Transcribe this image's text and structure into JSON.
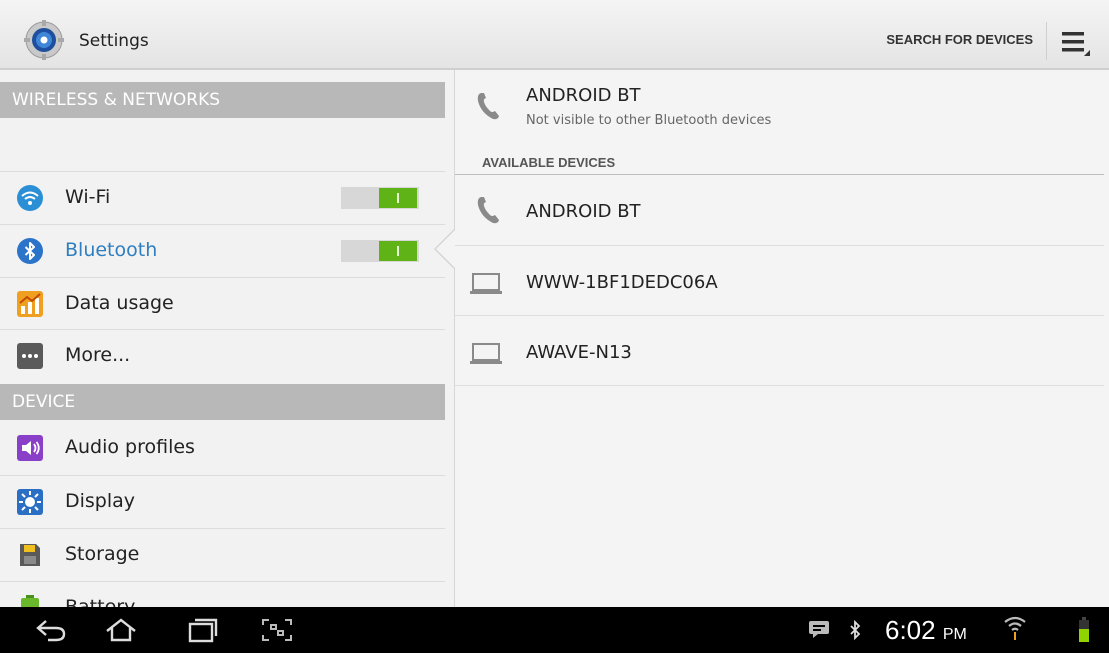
{
  "actionbar": {
    "title": "Settings",
    "search_label": "SEARCH FOR DEVICES"
  },
  "sidebar": {
    "sections": {
      "wireless": "WIRELESS & NETWORKS",
      "device": "DEVICE"
    },
    "items": {
      "wifi": {
        "label": "Wi-Fi",
        "toggle": "on"
      },
      "bluetooth": {
        "label": "Bluetooth",
        "toggle": "on",
        "selected": true
      },
      "data_usage": {
        "label": "Data usage"
      },
      "more": {
        "label": "More..."
      },
      "audio_profiles": {
        "label": "Audio profiles"
      },
      "display": {
        "label": "Display"
      },
      "storage": {
        "label": "Storage"
      },
      "battery": {
        "label": "Battery"
      }
    }
  },
  "bluetooth": {
    "this_device": {
      "name": "ANDROID BT",
      "status": "Not visible to other Bluetooth devices"
    },
    "available_header": "AVAILABLE DEVICES",
    "devices": [
      {
        "name": "ANDROID BT",
        "icon": "phone-icon"
      },
      {
        "name": "WWW-1BF1DEDC06A",
        "icon": "laptop-icon"
      },
      {
        "name": "AWAVE-N13",
        "icon": "laptop-icon"
      }
    ]
  },
  "statusbar": {
    "time": "6:02",
    "ampm": "PM"
  },
  "colors": {
    "accent_blue": "#2f7fc0",
    "toggle_on": "#5fb317",
    "section_header": "#b8b8b8"
  }
}
